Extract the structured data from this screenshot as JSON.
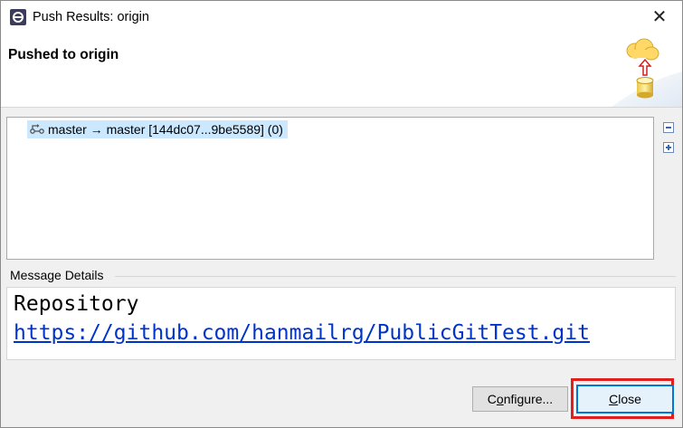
{
  "window": {
    "title": "Push Results: origin",
    "close_glyph": "✕"
  },
  "banner": {
    "title": "Pushed to origin",
    "art_icon": "cloud-push-database-icon"
  },
  "results": {
    "rows": [
      {
        "icon": "push-branch-icon",
        "label": "master → master [144dc07...9be5589] (0)",
        "selected": true
      }
    ],
    "collapse_icon": "collapse-all-icon",
    "expand_icon": "expand-all-icon"
  },
  "details": {
    "group_label": "Message Details",
    "line1": "Repository",
    "line2": "https://github.com/hanmailrg/PublicGitTest.git"
  },
  "buttons": {
    "configure_prefix": "C",
    "configure_mnemonic": "o",
    "configure_rest": "nfigure...",
    "close_mnemonic": "C",
    "close_rest": "lose"
  },
  "colors": {
    "selection": "#cce8ff",
    "link": "#0033cc",
    "highlight_box": "#e0201e",
    "default_button_border": "#0078d7"
  }
}
